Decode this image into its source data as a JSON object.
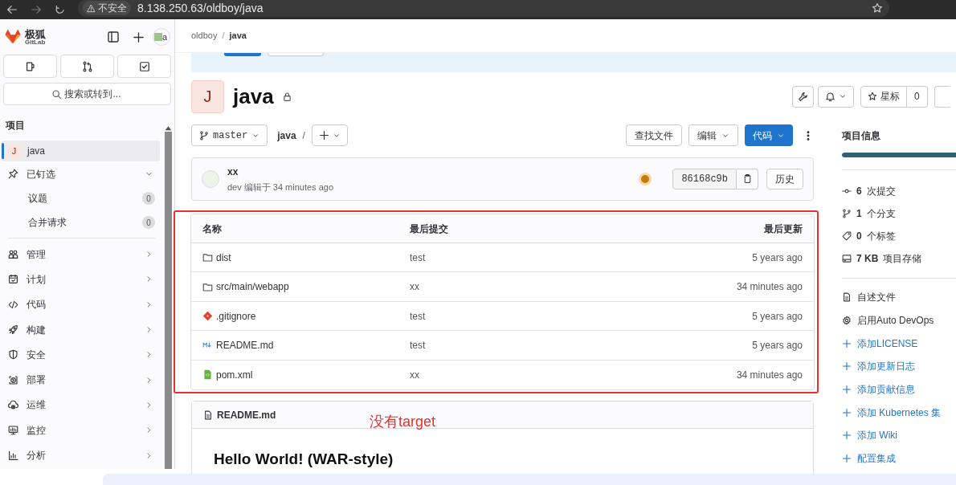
{
  "browser": {
    "warning": "不安全",
    "url": "8.138.250.63/oldboy/java"
  },
  "sidebar": {
    "brand": "极狐",
    "brand_sub": "GitLab",
    "avatar_alt": "a",
    "search": {
      "placeholder": "搜索或转到..."
    },
    "section": "项目",
    "items": [
      {
        "kind": "project",
        "initial": "J",
        "label": "java",
        "selected": true
      },
      {
        "kind": "pinned",
        "label": "已钉选",
        "expanded": true,
        "children": [
          {
            "label": "议题",
            "count": "0"
          },
          {
            "label": "合并请求",
            "count": "0"
          }
        ]
      },
      {
        "kind": "menu",
        "label": "管理"
      },
      {
        "kind": "menu",
        "label": "计划"
      },
      {
        "kind": "menu",
        "label": "代码"
      },
      {
        "kind": "menu",
        "label": "构建"
      },
      {
        "kind": "menu",
        "label": "安全"
      },
      {
        "kind": "menu",
        "label": "部署"
      },
      {
        "kind": "menu",
        "label": "运维"
      },
      {
        "kind": "menu",
        "label": "监控"
      },
      {
        "kind": "menu",
        "label": "分析"
      }
    ]
  },
  "breadcrumb": {
    "items": [
      "oldboy",
      "java"
    ],
    "separator": "/"
  },
  "project": {
    "initial": "J",
    "name": "java",
    "star_label": "星标",
    "star_count": "0"
  },
  "repo_bar": {
    "branch": "master",
    "path": "java",
    "separator": "/",
    "find_file": "查找文件",
    "edit": "编辑",
    "code": "代码"
  },
  "commit": {
    "title": "xx",
    "author": "dev",
    "meta": "编辑于 34 minutes ago",
    "sha": "86168c9b",
    "history": "历史"
  },
  "table": {
    "columns": [
      "名称",
      "最后提交",
      "最后更新"
    ],
    "rows": [
      {
        "kind": "folder",
        "name": "dist",
        "commit": "test",
        "updated": "5 years ago"
      },
      {
        "kind": "folder",
        "name": "src/main/webapp",
        "commit": "xx",
        "updated": "34 minutes ago"
      },
      {
        "kind": "git",
        "name": ".gitignore",
        "commit": "test",
        "updated": "5 years ago"
      },
      {
        "kind": "markdown",
        "name": "README.md",
        "commit": "test",
        "updated": "5 years ago"
      },
      {
        "kind": "xml",
        "name": "pom.xml",
        "commit": "xx",
        "updated": "34 minutes ago"
      }
    ]
  },
  "annotation": "没有target",
  "readme": {
    "title": "README.md",
    "heading": "Hello World! (WAR-style)"
  },
  "project_info": {
    "title": "项目信息",
    "language_bar": {
      "level": 1
    },
    "stats": [
      {
        "kind": "commits",
        "count": "6",
        "label": "次提交"
      },
      {
        "kind": "branches",
        "count": "1",
        "label": "个分支"
      },
      {
        "kind": "tags",
        "count": "0",
        "label": "个标签"
      },
      {
        "kind": "storage",
        "count": "7 KB",
        "label": "项目存储"
      }
    ],
    "links": [
      {
        "kind": "file",
        "label": "自述文件"
      },
      {
        "kind": "gear",
        "label": "启用Auto DevOps"
      },
      {
        "kind": "add",
        "label": "添加LICENSE"
      },
      {
        "kind": "add",
        "label": "添加更新日志"
      },
      {
        "kind": "add",
        "label": "添加贡献信息"
      },
      {
        "kind": "add",
        "label": "添加 Kubernetes 集"
      },
      {
        "kind": "add",
        "label": "添加 Wiki"
      },
      {
        "kind": "add",
        "label": "配置集成"
      }
    ]
  }
}
